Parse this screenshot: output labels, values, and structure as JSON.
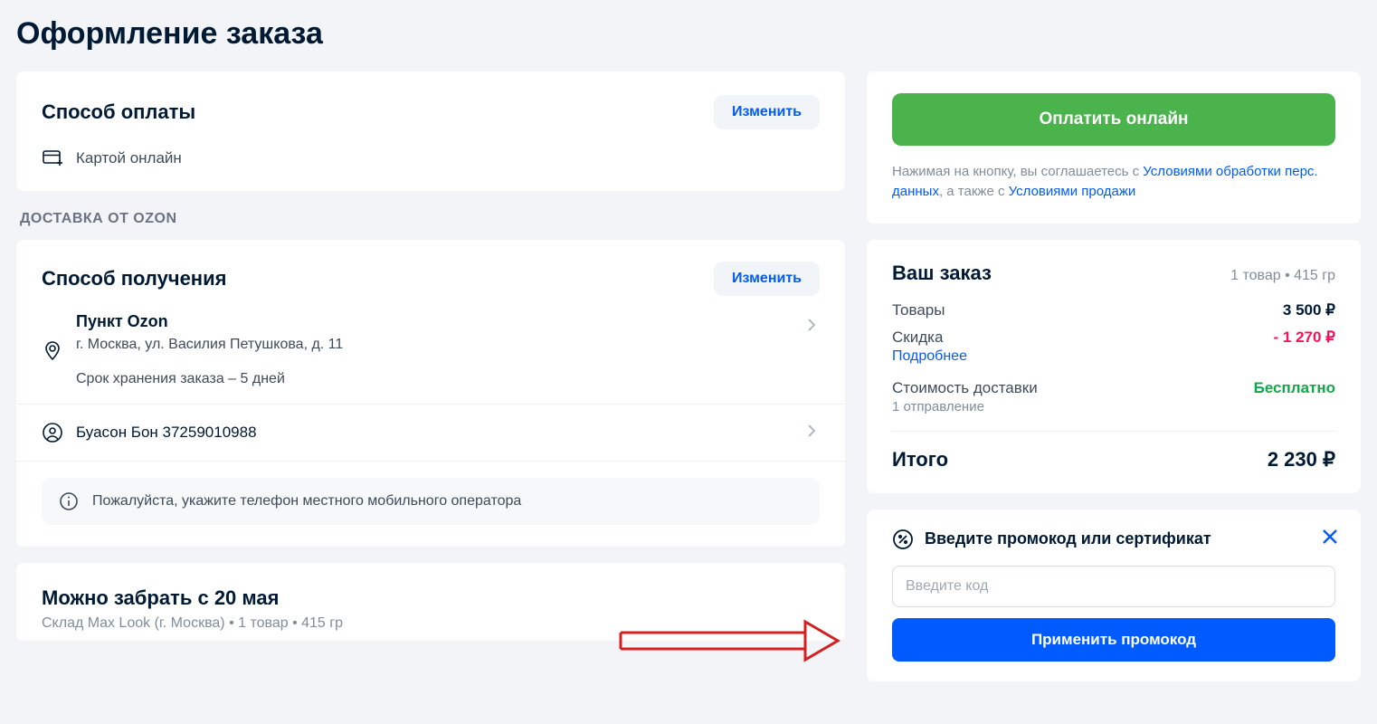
{
  "page": {
    "title": "Оформление заказа"
  },
  "payment": {
    "heading": "Способ оплаты",
    "change_label": "Изменить",
    "method": "Картой онлайн"
  },
  "delivery_section_label": "ДОСТАВКА ОТ OZON",
  "delivery": {
    "heading": "Способ получения",
    "change_label": "Изменить",
    "pickup_title": "Пункт Ozon",
    "pickup_address": "г. Москва, ул. Василия Петушкова, д. 11",
    "storage_text": "Срок хранения заказа – 5 дней",
    "recipient": "Буасон Бон 37259010988",
    "notice": "Пожалуйста, укажите телефон местного мобильного оператора"
  },
  "pickup": {
    "heading": "Можно забрать с 20 мая",
    "sub": "Склад Max Look (г. Москва) • 1 товар • 415 гр"
  },
  "pay": {
    "button": "Оплатить онлайн",
    "agree_prefix": "Нажимая на кнопку, вы соглашаетесь с ",
    "link1": "Условиями обработки перс. данных",
    "agree_mid": ", а также с ",
    "link2": "Условиями продажи"
  },
  "summary": {
    "title": "Ваш заказ",
    "meta": "1 товар • 415 гр",
    "items_label": "Товары",
    "items_value": "3 500 ₽",
    "discount_label": "Скидка",
    "discount_value": "- 1 270 ₽",
    "more": "Подробнее",
    "shipping_label": "Стоимость доставки",
    "shipping_sub": "1 отправление",
    "shipping_value": "Бесплатно",
    "total_label": "Итого",
    "total_value": "2 230 ₽"
  },
  "promo": {
    "title": "Введите промокод или сертификат",
    "placeholder": "Введите код",
    "apply": "Применить промокод"
  }
}
